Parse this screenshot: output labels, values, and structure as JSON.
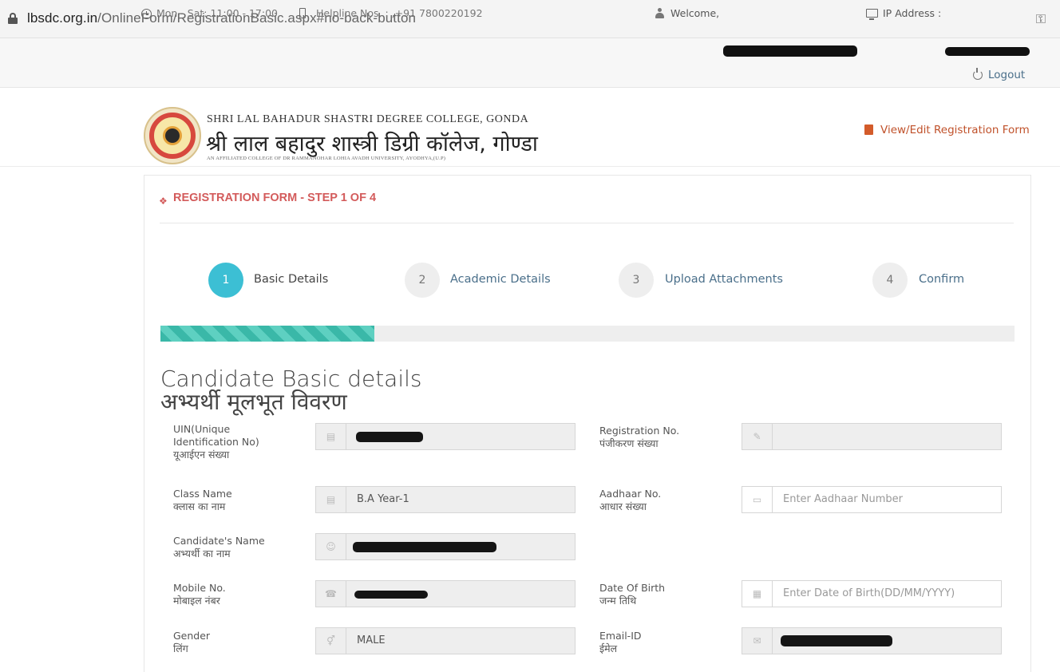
{
  "browser": {
    "url_host": "lbsdc.org.in",
    "url_path": "/OnlineForm/RegistrationBasic.aspx#no-back-button"
  },
  "topbar": {
    "hours": "Mon - Sat: 11:00 - 17:00",
    "helpline": "Helpline Nos. : ,+91 7800220192",
    "welcome_label": "Welcome,",
    "ip_label": "IP Address :",
    "logout_label": "Logout"
  },
  "header": {
    "college_name_en": "SHRI LAL BAHADUR SHASTRI DEGREE COLLEGE, GONDA",
    "college_name_hi": "श्री लाल बहादुर शास्त्री डिग्री कॉलेज, गोण्डा",
    "college_affiliation": "AN AFFILIATED COLLEGE OF DR RAMMANOHAR LOHIA AVADH UNIVERSITY, AYODHYA,(U.P)",
    "view_edit_link": "View/Edit Registration Form"
  },
  "form": {
    "title": "REGISTRATION FORM - STEP 1 OF 4",
    "steps": [
      {
        "number": "1",
        "label": "Basic Details",
        "active": true
      },
      {
        "number": "2",
        "label": "Academic Details",
        "active": false
      },
      {
        "number": "3",
        "label": "Upload Attachments",
        "active": false
      },
      {
        "number": "4",
        "label": "Confirm",
        "active": false
      }
    ],
    "progress_fraction": 0.25,
    "section_title_en": "Candidate Basic details",
    "section_title_hi": "अभ्यर्थी मूलभूत विवरण"
  },
  "fields": {
    "uin": {
      "label_en_1": "UIN(Unique",
      "label_en_2": "Identification No)",
      "label_hi": "यूआईएन संख्या"
    },
    "registration_no": {
      "label_en": "Registration No.",
      "label_hi": "पंजीकरण संख्या"
    },
    "class_name": {
      "label_en": "Class Name",
      "label_hi": "क्लास का नाम",
      "value": "B.A Year-1"
    },
    "aadhaar_no": {
      "label_en": "Aadhaar No.",
      "label_hi": "आधार संख्या",
      "placeholder": "Enter Aadhaar Number"
    },
    "candidate_name": {
      "label_en": "Candidate's Name",
      "label_hi": "अभ्यर्थी का नाम"
    },
    "mobile_no": {
      "label_en": "Mobile No.",
      "label_hi": "मोबाइल नंबर"
    },
    "dob": {
      "label_en": "Date Of Birth",
      "label_hi": "जन्म तिथि",
      "placeholder": "Enter Date of Birth(DD/MM/YYYY)"
    },
    "gender": {
      "label_en": "Gender",
      "label_hi": "लिंग",
      "value": "MALE"
    },
    "email": {
      "label_en": "Email-ID",
      "label_hi": "ईमेल"
    }
  },
  "colors": {
    "accent_teal": "#3cbfd4",
    "title_red": "#d35b5b",
    "link_blue": "#4a6f8a",
    "link_orange": "#c0512a"
  }
}
